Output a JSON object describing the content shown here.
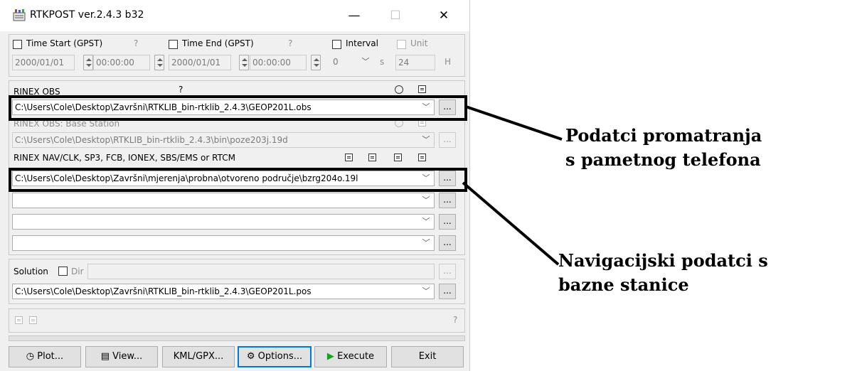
{
  "window": {
    "title": "RTKPOST ver.2.4.3 b32",
    "controls": {
      "minimize": "—",
      "maximize": "☐",
      "close": "✕"
    }
  },
  "time": {
    "start_label": "Time Start (GPST)",
    "start_help": "?",
    "start_date": "2000/01/01",
    "start_time": "00:00:00",
    "end_label": "Time End (GPST)",
    "end_help": "?",
    "end_date": "2000/01/01",
    "end_time": "00:00:00",
    "interval_label": "Interval",
    "interval_value": "0",
    "interval_unit": "s",
    "unit_label": "Unit",
    "unit_value": "24",
    "unit_suffix": "H"
  },
  "inputs": {
    "rover_label": "RINEX OBS",
    "rover_help": "?",
    "rover_path": "C:\\Users\\Cole\\Desktop\\Završni\\RTKLIB_bin-rtklib_2.4.3\\GEOP201L.obs",
    "base_label": "RINEX OBS: Base Station",
    "base_path": "C:\\Users\\Cole\\Desktop\\RTKLIB_bin-rtklib_2.4.3\\bin\\poze203j.19d",
    "nav_label": "RINEX NAV/CLK, SP3, FCB, IONEX, SBS/EMS  or RTCM",
    "nav_paths": [
      "C:\\Users\\Cole\\Desktop\\Završni\\mjerenja\\probna\\otvoreno područje\\bzrg204o.19l",
      "",
      "",
      ""
    ],
    "browse_label": "..."
  },
  "output": {
    "solution_label": "Solution",
    "dir_label": "Dir",
    "dir_value": "",
    "solution_path": "C:\\Users\\Cole\\Desktop\\Završni\\RTKLIB_bin-rtklib_2.4.3\\GEOP201L.pos",
    "status_help": "?"
  },
  "buttons": {
    "plot": "Plot...",
    "view": "View...",
    "kml": "KML/GPX...",
    "options": "Options...",
    "execute": "Execute",
    "exit": "Exit"
  },
  "annotations": {
    "rover": [
      "Podatci promatranja",
      "s pametnog telefona"
    ],
    "nav": [
      "Navigacijski podatci s",
      "bazne stanice"
    ]
  },
  "icons": {
    "app": "rtkpost-app-icon",
    "plot": "plot-icon",
    "view": "view-icon",
    "options": "gear-icon",
    "execute": "play-icon",
    "colors": {
      "play": "#1aa31a",
      "focus": "#0078d7"
    }
  }
}
